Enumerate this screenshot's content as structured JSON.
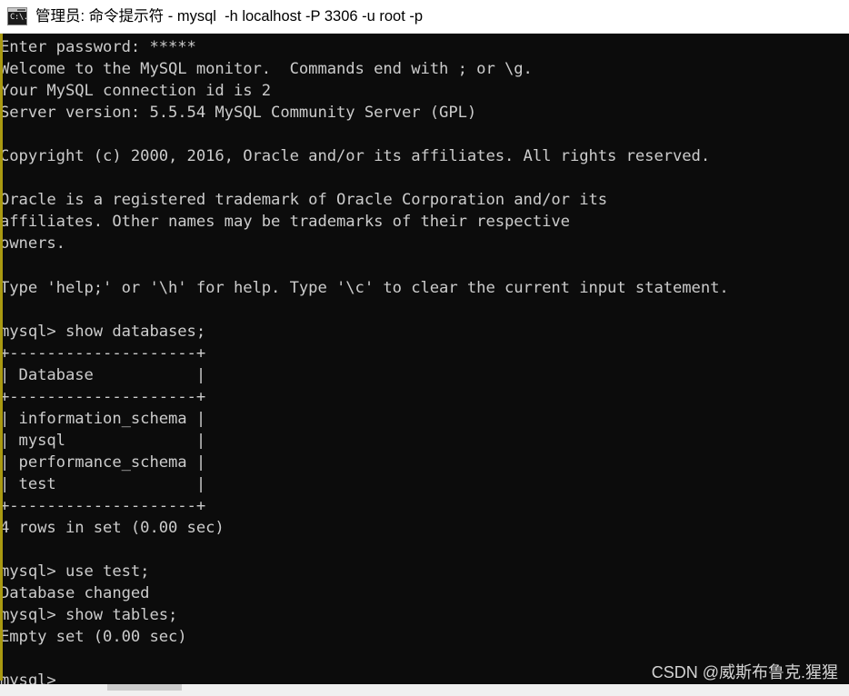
{
  "window": {
    "title": "管理员: 命令提示符 - mysql  -h localhost -P 3306 -u root -p",
    "icon": "command-prompt-icon",
    "icon_glyph": "C:\\.",
    "background_color": "#0c0c0c",
    "titlebar_background": "#ffffff",
    "titlebar_text_color": "#000000",
    "left_edge_color": "#aa9a11",
    "text_color": "#cccccc"
  },
  "terminal": {
    "lines": [
      "Enter password: *****",
      "Welcome to the MySQL monitor.  Commands end with ; or \\g.",
      "Your MySQL connection id is 2",
      "Server version: 5.5.54 MySQL Community Server (GPL)",
      "",
      "Copyright (c) 2000, 2016, Oracle and/or its affiliates. All rights reserved.",
      "",
      "Oracle is a registered trademark of Oracle Corporation and/or its",
      "affiliates. Other names may be trademarks of their respective",
      "owners.",
      "",
      "Type 'help;' or '\\h' for help. Type '\\c' to clear the current input statement.",
      "",
      "mysql> show databases;",
      "+--------------------+",
      "| Database           |",
      "+--------------------+",
      "| information_schema |",
      "| mysql              |",
      "| performance_schema |",
      "| test               |",
      "+--------------------+",
      "4 rows in set (0.00 sec)",
      "",
      "mysql> use test;",
      "Database changed",
      "mysql> show tables;",
      "Empty set (0.00 sec)",
      "",
      "mysql>"
    ],
    "prompt": "mysql>",
    "commands_entered": [
      "show databases;",
      "use test;",
      "show tables;"
    ],
    "password_masked": "*****",
    "mysql_version": "5.5.54",
    "mysql_edition": "MySQL Community Server (GPL)",
    "connection_id": "2",
    "databases": [
      "information_schema",
      "mysql",
      "performance_schema",
      "test"
    ],
    "databases_column_header": "Database",
    "databases_result_status": "4 rows in set (0.00 sec)",
    "use_result_status": "Database changed",
    "tables_result_status": "Empty set (0.00 sec)",
    "copyright": "Copyright (c) 2000, 2016, Oracle and/or its affiliates. All rights reserved."
  },
  "watermark": {
    "text": "CSDN @威斯布鲁克.猩猩"
  }
}
